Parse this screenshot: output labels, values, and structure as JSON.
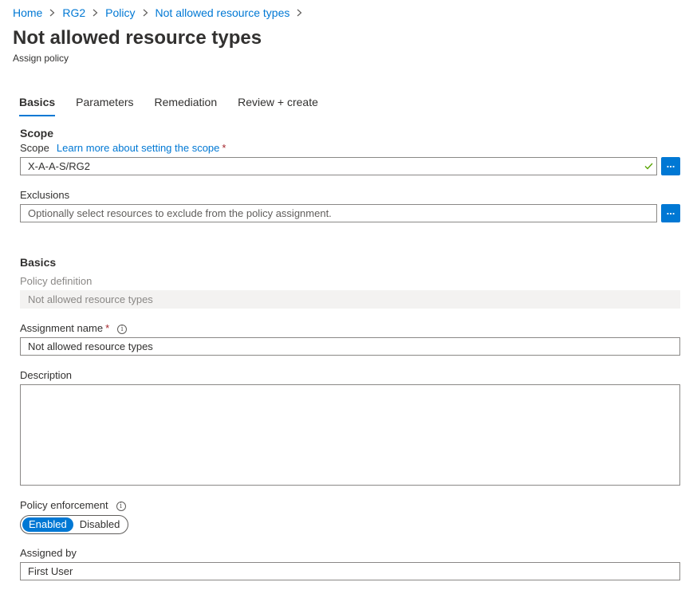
{
  "breadcrumb": [
    "Home",
    "RG2",
    "Policy",
    "Not allowed resource types"
  ],
  "title": "Not allowed resource types",
  "subtitle": "Assign policy",
  "tabs": [
    "Basics",
    "Parameters",
    "Remediation",
    "Review + create"
  ],
  "active_tab": "Basics",
  "scope_section": {
    "heading": "Scope",
    "scope_label": "Scope",
    "scope_link": "Learn more about setting the scope",
    "required_mark": "*",
    "scope_value": "X-A-A-S/RG2",
    "ellipsis": "...",
    "exclusions_label": "Exclusions",
    "exclusions_placeholder": "Optionally select resources to exclude from the policy assignment."
  },
  "basics_section": {
    "heading": "Basics",
    "policy_definition_label": "Policy definition",
    "policy_definition_value": "Not allowed resource types",
    "assignment_name_label": "Assignment name",
    "assignment_name_value": "Not allowed resource types",
    "description_label": "Description",
    "description_value": "",
    "policy_enforcement_label": "Policy enforcement",
    "enforcement_options": [
      "Enabled",
      "Disabled"
    ],
    "enforcement_selected": "Enabled",
    "assigned_by_label": "Assigned by",
    "assigned_by_value": "First User"
  },
  "colors": {
    "accent": "#0078d4",
    "required": "#a4262c",
    "valid_check": "#57a300"
  },
  "icons": [
    "chevron-right-icon",
    "info-icon",
    "checkmark-icon"
  ]
}
